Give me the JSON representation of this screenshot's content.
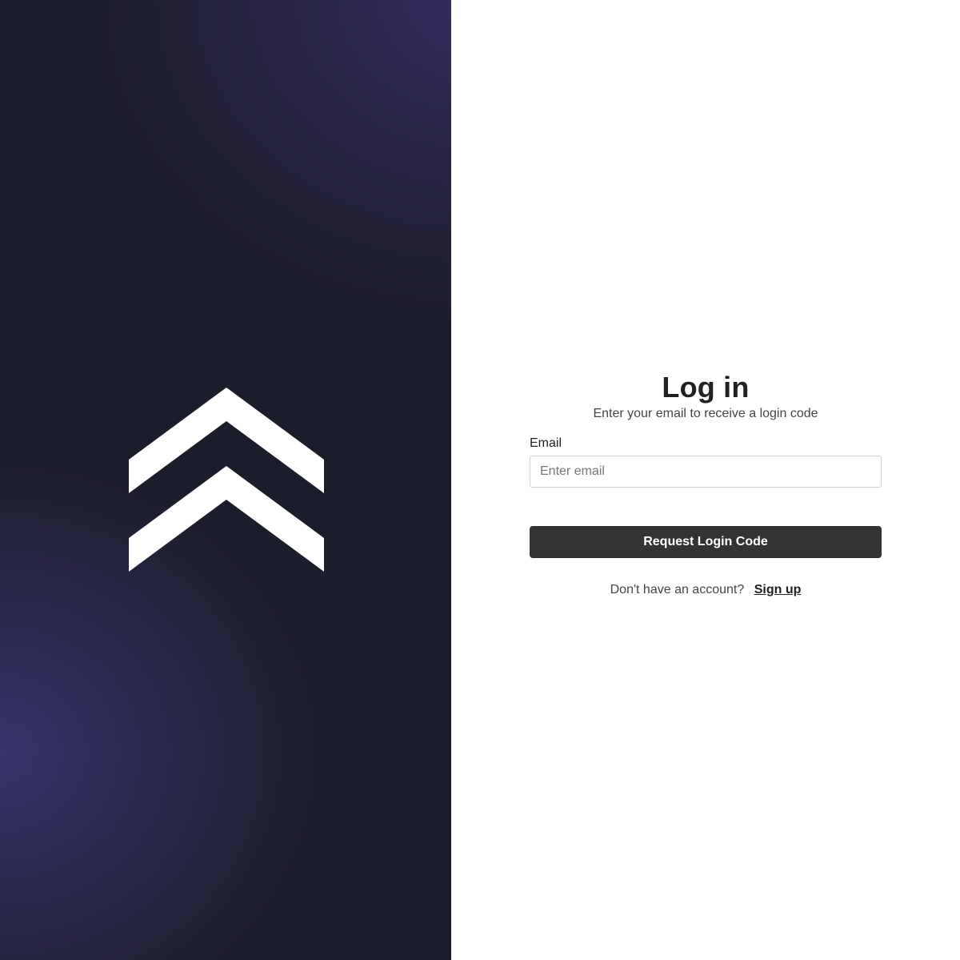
{
  "brand": {
    "logo_icon": "double-chevron-up-icon",
    "logo_color": "#ffffff",
    "background_color": "#1c1d2a",
    "accent_color": "#3a3470"
  },
  "login": {
    "title": "Log in",
    "subtitle": "Enter your email to receive a login code",
    "email_label": "Email",
    "email_placeholder": "Enter email",
    "email_value": "",
    "submit_label": "Request Login Code",
    "submit_color": "#333333",
    "signup_prompt": "Don't have an account?",
    "signup_link": "Sign up"
  }
}
